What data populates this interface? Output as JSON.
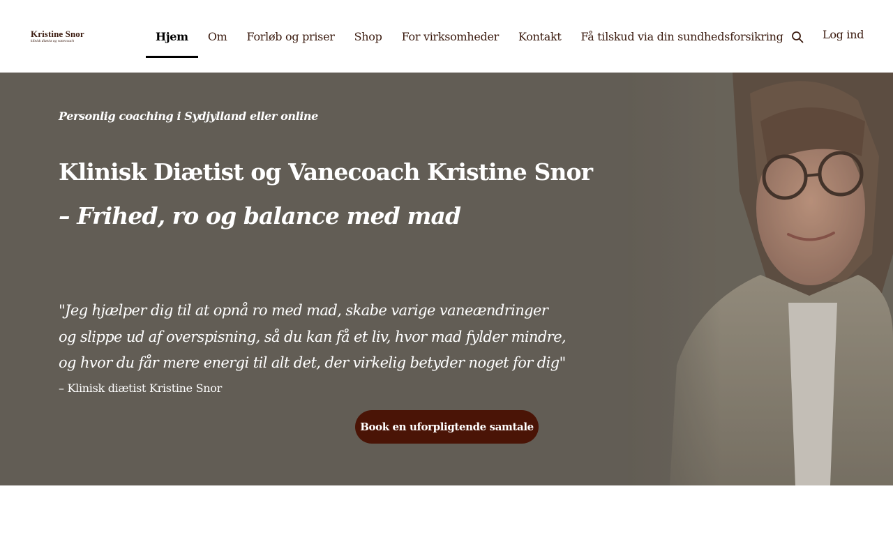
{
  "header": {
    "logo": {
      "name": "Kristine Snor",
      "tagline": "klinisk diætist og vanecoach"
    },
    "nav": [
      {
        "label": "Hjem",
        "active": true
      },
      {
        "label": "Om",
        "active": false
      },
      {
        "label": "Forløb og priser",
        "active": false
      },
      {
        "label": "Shop",
        "active": false
      },
      {
        "label": "For virksomheder",
        "active": false
      },
      {
        "label": "Kontakt",
        "active": false
      },
      {
        "label": "Få tilskud via din sundhedsforsikring",
        "active": false
      }
    ],
    "search_icon": "search-icon",
    "login_label": "Log ind"
  },
  "hero": {
    "kicker": "Personlig coaching i Sydjylland eller online",
    "title": "Klinisk Diætist og Vanecoach Kristine Snor",
    "subtitle": "– Frihed, ro og balance med mad",
    "quote_lines": [
      "\"Jeg hjælper dig til at opnå ro med mad, skabe varige vaneændringer",
      "og slippe ud af overspisning, så du kan få et liv, hvor mad fylder mindre,",
      "og hvor du får mere energi til alt det, der virkelig betyder noget for dig\""
    ],
    "attribution": "– Klinisk diætist Kristine Snor",
    "cta_label": "Book en uforpligtende samtale"
  },
  "colors": {
    "brand_dark": "#4a1406",
    "nav_text": "#3a1a0e",
    "hero_bg": "#625d55",
    "white": "#ffffff"
  }
}
